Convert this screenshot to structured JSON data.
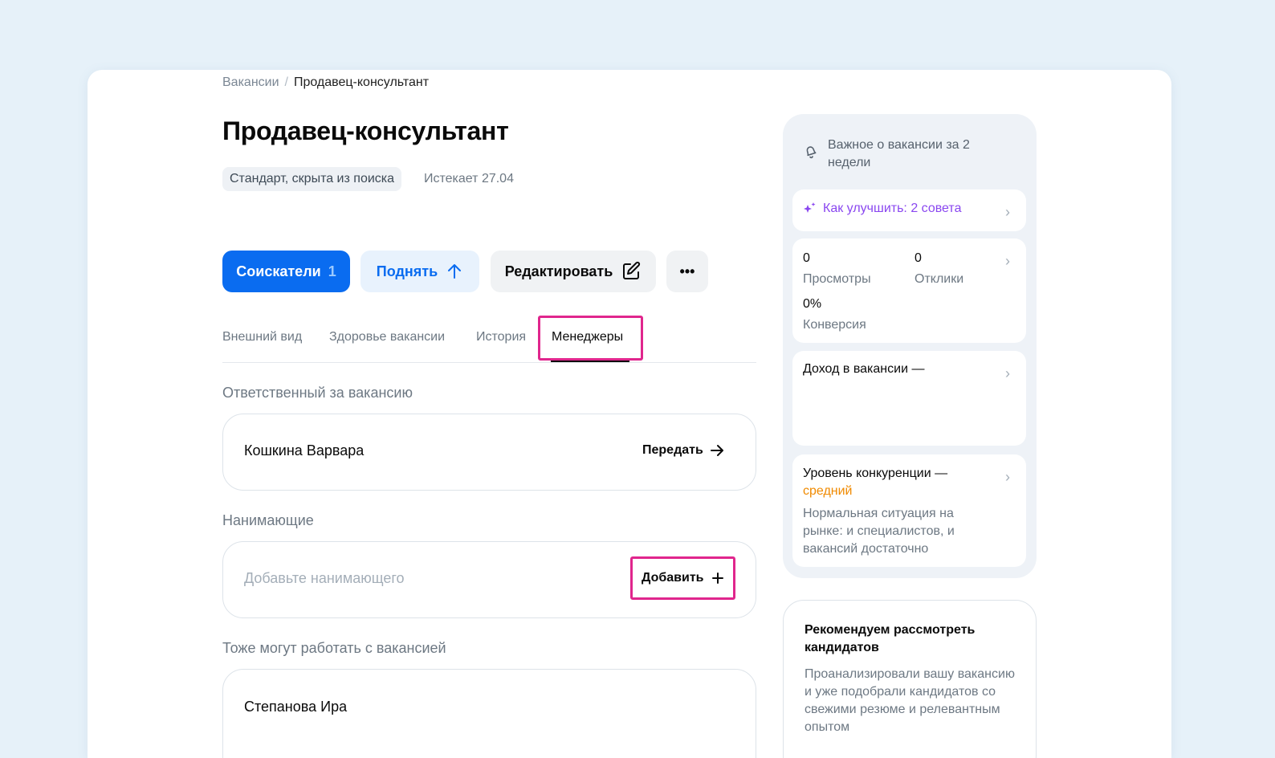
{
  "breadcrumb": {
    "parent": "Вакансии",
    "separator": "/",
    "current": "Продавец-консультант"
  },
  "title": "Продавец-консультант",
  "badge": "Стандарт, скрыта из поиска",
  "expires": "Истекает 27.04",
  "actions": {
    "applicants_label": "Соискатели",
    "applicants_count": "1",
    "raise_label": "Поднять",
    "edit_label": "Редактировать",
    "more_label": "•••"
  },
  "tabs": [
    "Внешний вид",
    "Здоровье вакансии",
    "История",
    "Менеджеры"
  ],
  "sections": {
    "responsible": {
      "label": "Ответственный за вакансию",
      "name": "Кошкина Варвара",
      "action": "Передать"
    },
    "hiring": {
      "label": "Нанимающие",
      "placeholder": "Добавьте нанимающего",
      "action": "Добавить"
    },
    "also": {
      "label": "Тоже могут работать с вакансией",
      "name": "Степанова Ира"
    }
  },
  "sidebar": {
    "header": "Важное о вакансии за 2 недели",
    "improve": "Как улучшить: 2 совета",
    "stats": {
      "views_value": "0",
      "views_label": "Просмотры",
      "responses_value": "0",
      "responses_label": "Отклики",
      "conversion_value": "0%",
      "conversion_label": "Конверсия"
    },
    "income": "Доход в вакансии —",
    "competition_title": "Уровень конкуренции —",
    "competition_level": "средний",
    "competition_desc": "Нормальная ситуация на рынке: и специалистов, и вакансий достаточно"
  },
  "recommend": {
    "title": "Рекомендуем рассмотреть кандидатов",
    "desc": "Проанализировали вашу вакансию и уже подобрали кандидатов со свежими резюме и релевантным опытом"
  },
  "colors": {
    "primary": "#0a6cf0",
    "highlight": "#e0268d",
    "accent_purple": "#8a47f0",
    "warning": "#f08a00"
  }
}
